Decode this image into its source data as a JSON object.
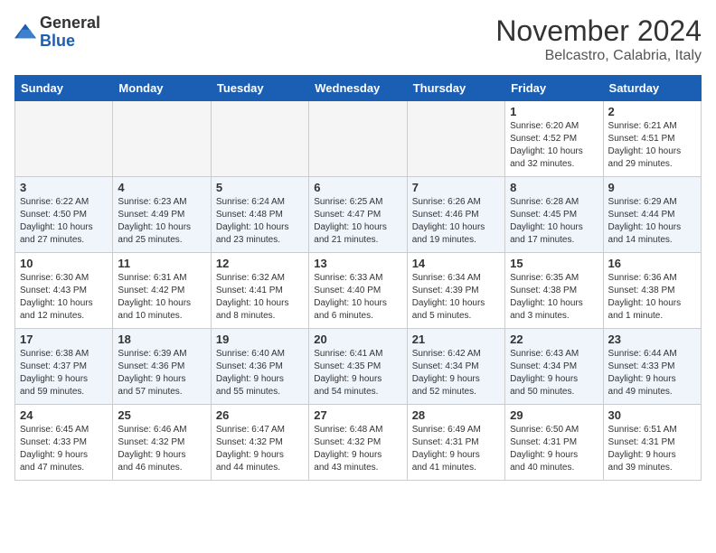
{
  "logo": {
    "general": "General",
    "blue": "Blue"
  },
  "header": {
    "month": "November 2024",
    "location": "Belcastro, Calabria, Italy"
  },
  "weekdays": [
    "Sunday",
    "Monday",
    "Tuesday",
    "Wednesday",
    "Thursday",
    "Friday",
    "Saturday"
  ],
  "weeks": [
    [
      {
        "day": "",
        "info": ""
      },
      {
        "day": "",
        "info": ""
      },
      {
        "day": "",
        "info": ""
      },
      {
        "day": "",
        "info": ""
      },
      {
        "day": "",
        "info": ""
      },
      {
        "day": "1",
        "info": "Sunrise: 6:20 AM\nSunset: 4:52 PM\nDaylight: 10 hours\nand 32 minutes."
      },
      {
        "day": "2",
        "info": "Sunrise: 6:21 AM\nSunset: 4:51 PM\nDaylight: 10 hours\nand 29 minutes."
      }
    ],
    [
      {
        "day": "3",
        "info": "Sunrise: 6:22 AM\nSunset: 4:50 PM\nDaylight: 10 hours\nand 27 minutes."
      },
      {
        "day": "4",
        "info": "Sunrise: 6:23 AM\nSunset: 4:49 PM\nDaylight: 10 hours\nand 25 minutes."
      },
      {
        "day": "5",
        "info": "Sunrise: 6:24 AM\nSunset: 4:48 PM\nDaylight: 10 hours\nand 23 minutes."
      },
      {
        "day": "6",
        "info": "Sunrise: 6:25 AM\nSunset: 4:47 PM\nDaylight: 10 hours\nand 21 minutes."
      },
      {
        "day": "7",
        "info": "Sunrise: 6:26 AM\nSunset: 4:46 PM\nDaylight: 10 hours\nand 19 minutes."
      },
      {
        "day": "8",
        "info": "Sunrise: 6:28 AM\nSunset: 4:45 PM\nDaylight: 10 hours\nand 17 minutes."
      },
      {
        "day": "9",
        "info": "Sunrise: 6:29 AM\nSunset: 4:44 PM\nDaylight: 10 hours\nand 14 minutes."
      }
    ],
    [
      {
        "day": "10",
        "info": "Sunrise: 6:30 AM\nSunset: 4:43 PM\nDaylight: 10 hours\nand 12 minutes."
      },
      {
        "day": "11",
        "info": "Sunrise: 6:31 AM\nSunset: 4:42 PM\nDaylight: 10 hours\nand 10 minutes."
      },
      {
        "day": "12",
        "info": "Sunrise: 6:32 AM\nSunset: 4:41 PM\nDaylight: 10 hours\nand 8 minutes."
      },
      {
        "day": "13",
        "info": "Sunrise: 6:33 AM\nSunset: 4:40 PM\nDaylight: 10 hours\nand 6 minutes."
      },
      {
        "day": "14",
        "info": "Sunrise: 6:34 AM\nSunset: 4:39 PM\nDaylight: 10 hours\nand 5 minutes."
      },
      {
        "day": "15",
        "info": "Sunrise: 6:35 AM\nSunset: 4:38 PM\nDaylight: 10 hours\nand 3 minutes."
      },
      {
        "day": "16",
        "info": "Sunrise: 6:36 AM\nSunset: 4:38 PM\nDaylight: 10 hours\nand 1 minute."
      }
    ],
    [
      {
        "day": "17",
        "info": "Sunrise: 6:38 AM\nSunset: 4:37 PM\nDaylight: 9 hours\nand 59 minutes."
      },
      {
        "day": "18",
        "info": "Sunrise: 6:39 AM\nSunset: 4:36 PM\nDaylight: 9 hours\nand 57 minutes."
      },
      {
        "day": "19",
        "info": "Sunrise: 6:40 AM\nSunset: 4:36 PM\nDaylight: 9 hours\nand 55 minutes."
      },
      {
        "day": "20",
        "info": "Sunrise: 6:41 AM\nSunset: 4:35 PM\nDaylight: 9 hours\nand 54 minutes."
      },
      {
        "day": "21",
        "info": "Sunrise: 6:42 AM\nSunset: 4:34 PM\nDaylight: 9 hours\nand 52 minutes."
      },
      {
        "day": "22",
        "info": "Sunrise: 6:43 AM\nSunset: 4:34 PM\nDaylight: 9 hours\nand 50 minutes."
      },
      {
        "day": "23",
        "info": "Sunrise: 6:44 AM\nSunset: 4:33 PM\nDaylight: 9 hours\nand 49 minutes."
      }
    ],
    [
      {
        "day": "24",
        "info": "Sunrise: 6:45 AM\nSunset: 4:33 PM\nDaylight: 9 hours\nand 47 minutes."
      },
      {
        "day": "25",
        "info": "Sunrise: 6:46 AM\nSunset: 4:32 PM\nDaylight: 9 hours\nand 46 minutes."
      },
      {
        "day": "26",
        "info": "Sunrise: 6:47 AM\nSunset: 4:32 PM\nDaylight: 9 hours\nand 44 minutes."
      },
      {
        "day": "27",
        "info": "Sunrise: 6:48 AM\nSunset: 4:32 PM\nDaylight: 9 hours\nand 43 minutes."
      },
      {
        "day": "28",
        "info": "Sunrise: 6:49 AM\nSunset: 4:31 PM\nDaylight: 9 hours\nand 41 minutes."
      },
      {
        "day": "29",
        "info": "Sunrise: 6:50 AM\nSunset: 4:31 PM\nDaylight: 9 hours\nand 40 minutes."
      },
      {
        "day": "30",
        "info": "Sunrise: 6:51 AM\nSunset: 4:31 PM\nDaylight: 9 hours\nand 39 minutes."
      }
    ]
  ]
}
